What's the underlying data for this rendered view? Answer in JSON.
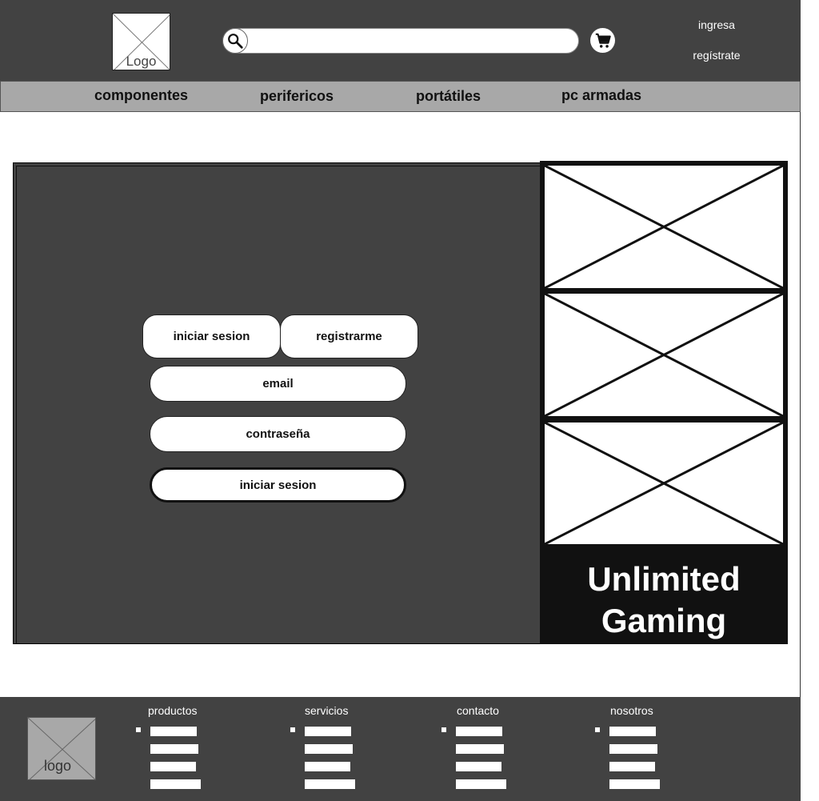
{
  "header": {
    "logo_label": "Logo",
    "search": {
      "placeholder": "",
      "value": ""
    },
    "auth": {
      "login_label": "ingresa",
      "register_label": "regístrate"
    }
  },
  "nav": {
    "items": [
      {
        "label": "componentes"
      },
      {
        "label": "perifericos"
      },
      {
        "label": "portátiles"
      },
      {
        "label": "pc armadas"
      }
    ]
  },
  "login_form": {
    "tab_login_label": "iniciar sesion",
    "tab_register_label": "registrarme",
    "email_placeholder": "email",
    "password_placeholder": "contraseña",
    "submit_label": "iniciar sesion"
  },
  "side_panel": {
    "title": "Unlimited Gaming"
  },
  "footer": {
    "logo_label": "logo",
    "columns": [
      {
        "title": "productos"
      },
      {
        "title": "servicios"
      },
      {
        "title": "contacto"
      },
      {
        "title": "nosotros"
      }
    ]
  },
  "icons": {
    "search": "search-icon",
    "cart": "cart-icon"
  },
  "colors": {
    "header_bg": "#424242",
    "nav_bg": "#a8a8a8",
    "panel_bg": "#424242",
    "side_bg": "#111111"
  }
}
